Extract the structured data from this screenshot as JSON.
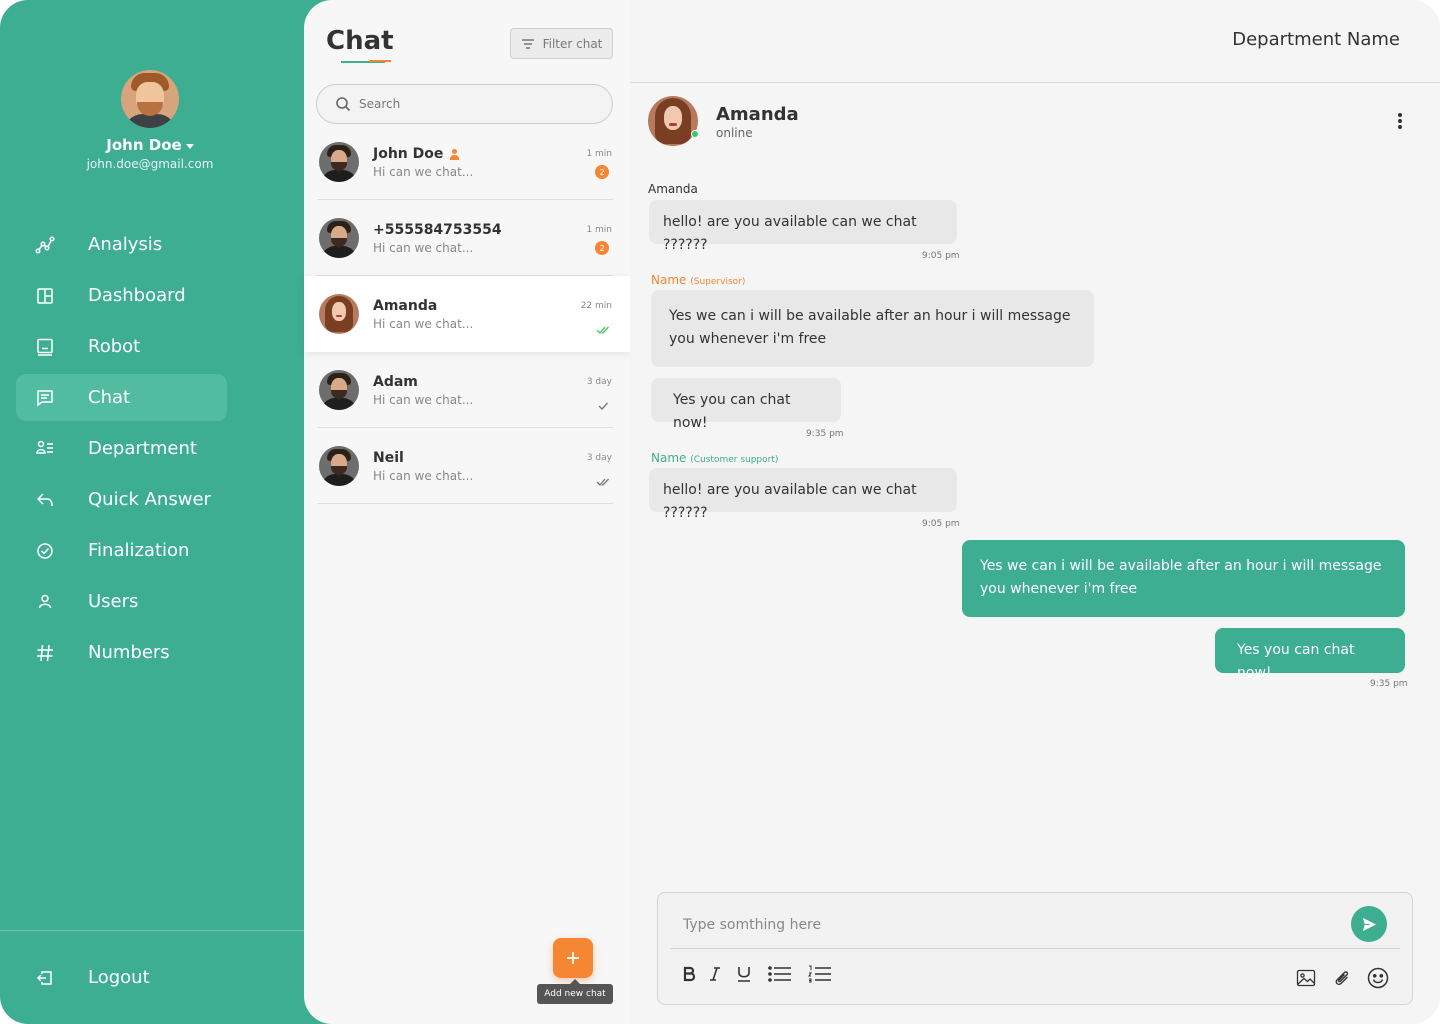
{
  "profile": {
    "name": "John Doe",
    "email": "john.doe@gmail.com"
  },
  "nav": [
    {
      "label": "Analysis",
      "icon": "analysis-icon"
    },
    {
      "label": "Dashboard",
      "icon": "dashboard-icon"
    },
    {
      "label": "Robot",
      "icon": "robot-icon"
    },
    {
      "label": "Chat",
      "icon": "chat-icon",
      "active": true
    },
    {
      "label": "Department",
      "icon": "department-icon"
    },
    {
      "label": "Quick Answer",
      "icon": "quick-answer-icon"
    },
    {
      "label": "Finalization",
      "icon": "finalization-icon"
    },
    {
      "label": "Users",
      "icon": "users-icon"
    },
    {
      "label": "Numbers",
      "icon": "numbers-icon"
    }
  ],
  "logout_label": "Logout",
  "chat_list": {
    "title": "Chat",
    "filter_label": "Filter chat",
    "search_placeholder": "Search",
    "items": [
      {
        "name": "John Doe",
        "preview": "Hi can we chat...",
        "time": "1 min",
        "unread": "2",
        "flag": "person-icon"
      },
      {
        "name": "+555584753554",
        "preview": "Hi can we chat...",
        "time": "1 min",
        "unread": "2"
      },
      {
        "name": "Amanda",
        "preview": "Hi can we chat...",
        "time": "22 min",
        "status": "read",
        "active": true
      },
      {
        "name": "Adam",
        "preview": "Hi can we chat...",
        "time": "3 day",
        "status": "sent"
      },
      {
        "name": "Neil",
        "preview": "Hi can we chat...",
        "time": "3 day",
        "status": "delivered"
      }
    ],
    "add_tooltip": "Add new chat"
  },
  "conversation": {
    "department": "Department Name",
    "contact_name": "Amanda",
    "contact_status": "online",
    "messages": [
      {
        "sender": "Amanda",
        "role": "",
        "text": "hello! are you available can we chat ??????",
        "time": "9:05 pm"
      },
      {
        "sender": "Name",
        "role": "(Supervisor)",
        "text": "Yes we can i will be available after an hour i will message you whenever i'm free",
        "time": ""
      },
      {
        "sender": "",
        "role": "",
        "text": "Yes you can chat now!",
        "time": "9:35 pm"
      },
      {
        "sender": "Name",
        "role": "(Customer support)",
        "text": "hello! are you available can we chat ??????",
        "time": "9:05 pm"
      },
      {
        "sender": "me",
        "role": "",
        "text": "Yes we can i will be available after an hour i will message you whenever i'm free",
        "time": ""
      },
      {
        "sender": "me",
        "role": "",
        "text": "Yes you can chat now!",
        "time": "9:35 pm"
      }
    ],
    "input_placeholder": "Type somthing here"
  },
  "colors": {
    "primary": "#3DAE91",
    "accent": "#F58634",
    "online": "#3CC764"
  }
}
